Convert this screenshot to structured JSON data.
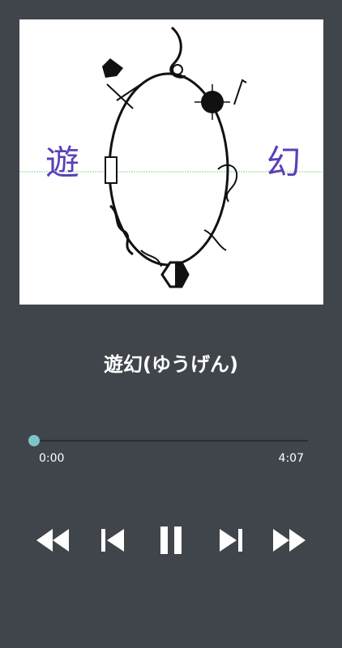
{
  "track": {
    "title": "遊幻(ゆうげん)"
  },
  "album_art": {
    "kanji_left": "遊",
    "kanji_right": "幻"
  },
  "playback": {
    "elapsed": "0:00",
    "duration": "4:07",
    "progress": 0.0,
    "state": "playing"
  },
  "controls": {
    "rewind_icon": "fast-rewind-icon",
    "previous_icon": "skip-previous-icon",
    "pause_icon": "pause-icon",
    "next_icon": "skip-next-icon",
    "forward_icon": "fast-forward-icon"
  },
  "colors": {
    "background": "#40444b",
    "accent": "#7fc4c4",
    "kanji": "#5a3fb8"
  }
}
